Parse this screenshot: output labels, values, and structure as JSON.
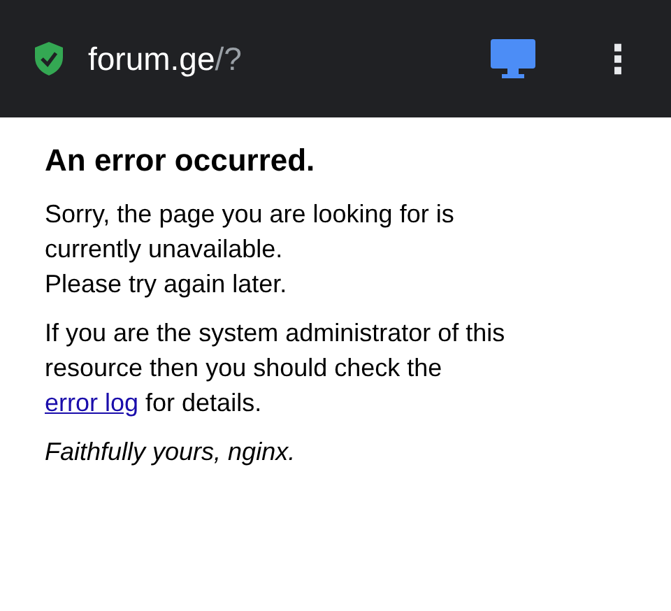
{
  "address_bar": {
    "secure": true,
    "domain": "forum.ge",
    "path": "/?",
    "desktop_mode": true,
    "menu": "⋮"
  },
  "page": {
    "heading": "An error occurred.",
    "paragraph_1": [
      "Sorry, the page you are looking for is currently unavailable.",
      "Please try again later."
    ],
    "paragraph_2": {
      "before": "If you are the system administrator of this resource then you should check the",
      "link": "error log",
      "after": "for details."
    },
    "signature": "Faithfully yours, nginx."
  }
}
